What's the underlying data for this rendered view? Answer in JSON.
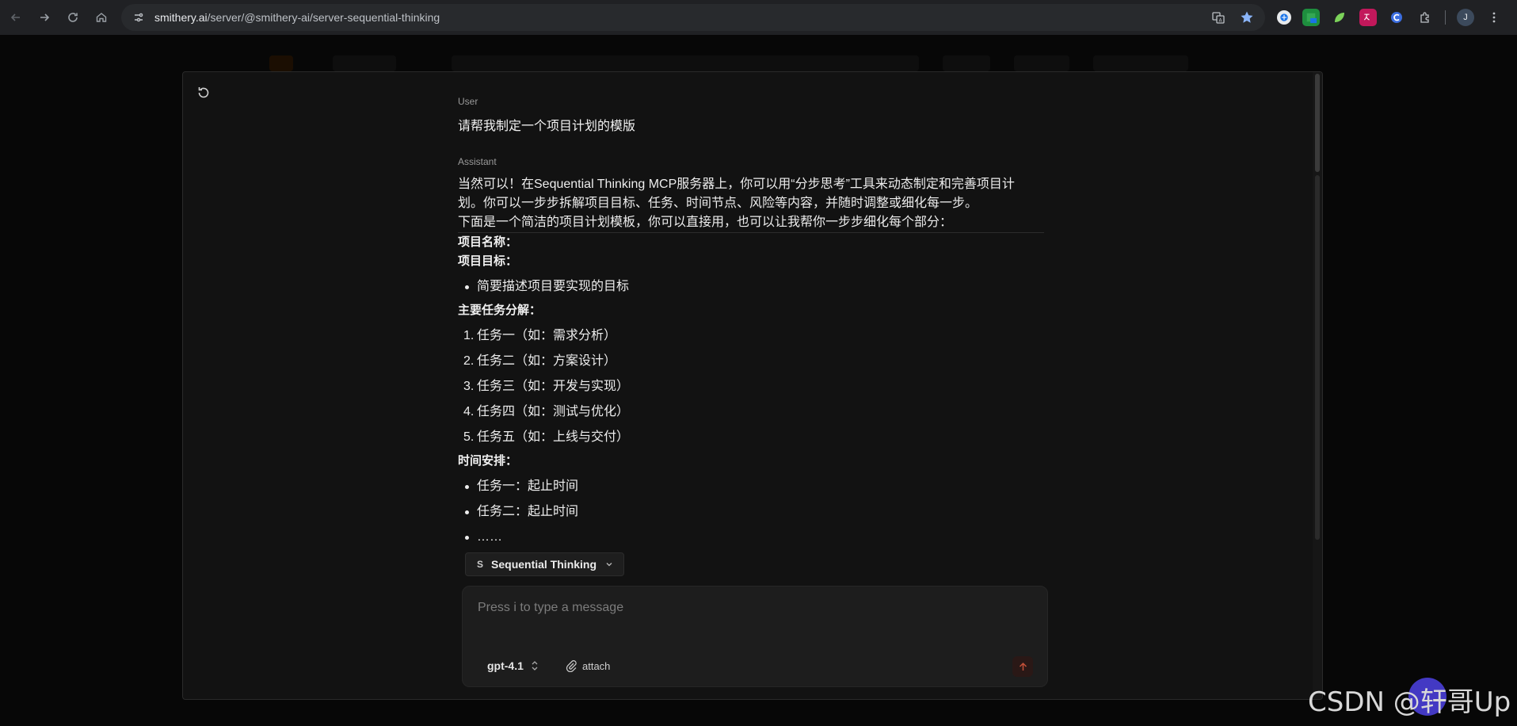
{
  "browser": {
    "url_host": "smithery.ai",
    "url_path": "/server/@smithery-ai/server-sequential-thinking",
    "profile_initial": "J"
  },
  "chat": {
    "user_role": "User",
    "user_message": "请帮我制定一个项目计划的模版",
    "assistant_role": "Assistant",
    "intro_line1": "当然可以！在Sequential Thinking MCP服务器上，你可以用“分步思考”工具来动态制定和完善项目计",
    "intro_line2": "划。你可以一步步拆解项目目标、任务、时间节点、风险等内容，并随时调整或细化每一步。",
    "intro_line3": "下面是一个简洁的项目计划模板，你可以直接用，也可以让我帮你一步步细化每个部分：",
    "project_name_label": "项目名称：",
    "project_goal_label": "项目目标：",
    "goal_items": [
      "简要描述项目要实现的目标"
    ],
    "tasks_label": "主要任务分解：",
    "tasks": [
      {
        "n": "1.",
        "text": "任务一（如：需求分析）"
      },
      {
        "n": "2.",
        "text": "任务二（如：方案设计）"
      },
      {
        "n": "3.",
        "text": "任务三（如：开发与实现）"
      },
      {
        "n": "4.",
        "text": "任务四（如：测试与优化）"
      },
      {
        "n": "5.",
        "text": "任务五（如：上线与交付）"
      }
    ],
    "schedule_label": "时间安排：",
    "schedule_items": [
      "任务一：起止时间",
      "任务二：起止时间",
      "……"
    ]
  },
  "composer": {
    "tool_badge": "S",
    "tool_name": "Sequential Thinking",
    "placeholder": "Press i to type a message",
    "model": "gpt-4.1",
    "attach_label": "attach"
  },
  "watermark": "CSDN @轩哥Up",
  "colors": {
    "send_accent": "#c45139",
    "background": "#121212"
  }
}
